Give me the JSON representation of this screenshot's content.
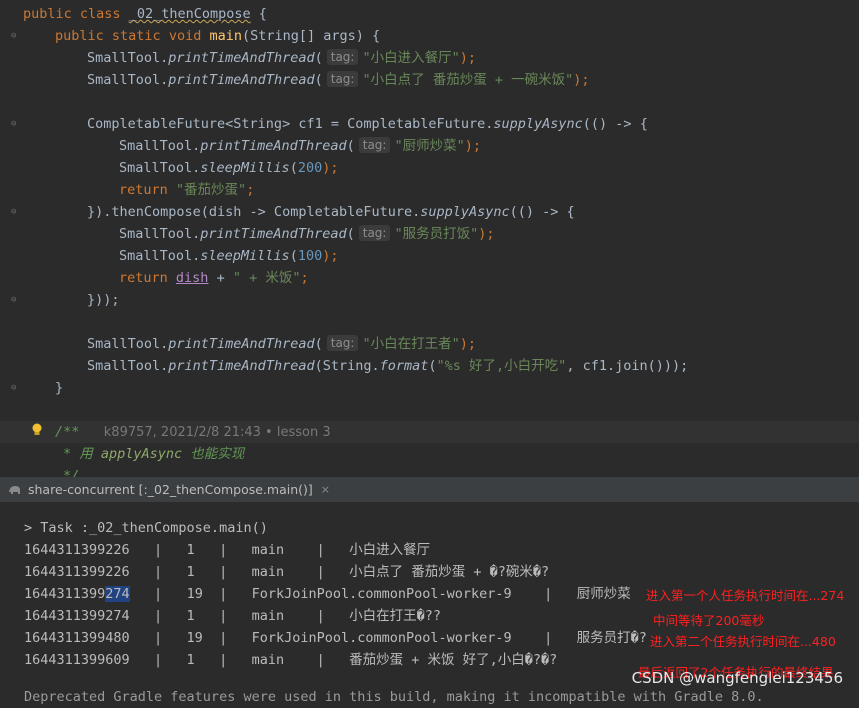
{
  "editor": {
    "class_decl": {
      "kw1": "public",
      "kw2": "class",
      "name": "_02_thenCompose",
      "brace": " {"
    },
    "main_decl": {
      "kw1": "public",
      "kw2": "static",
      "kw3": "void",
      "name": "main",
      "rest": "(String[] args) {"
    },
    "tag_label": "tag:",
    "l1": {
      "obj": "SmallTool.",
      "fn": "printTimeAndThread",
      "open": "(",
      "str": "\"小白进入餐厅\"",
      "close": ");"
    },
    "l2": {
      "obj": "SmallTool.",
      "fn": "printTimeAndThread",
      "open": "(",
      "str": "\"小白点了 番茄炒蛋 + 一碗米饭\"",
      "close": ");"
    },
    "l3": {
      "pre": "CompletableFuture<String> cf1 = CompletableFuture.",
      "fn": "supplyAsync",
      "post": "(() -> {"
    },
    "l4": {
      "obj": "SmallTool.",
      "fn": "printTimeAndThread",
      "open": "(",
      "str": "\"厨师炒菜\"",
      "close": ");"
    },
    "l5": {
      "obj": "SmallTool.",
      "fn": "sleepMillis",
      "open": "(",
      "num": "200",
      "close": ");"
    },
    "l6": {
      "kw": "return",
      "str": "\"番茄炒蛋\"",
      "close": ";"
    },
    "l7": {
      "pre": "}).thenCompose(dish -> CompletableFuture.",
      "fn": "supplyAsync",
      "post": "(() -> {"
    },
    "l8": {
      "obj": "SmallTool.",
      "fn": "printTimeAndThread",
      "open": "(",
      "str": "\"服务员打饭\"",
      "close": ");"
    },
    "l9": {
      "obj": "SmallTool.",
      "fn": "sleepMillis",
      "open": "(",
      "num": "100",
      "close": ");"
    },
    "l10": {
      "kw": "return",
      "var": "dish",
      "mid": " + ",
      "str": "\" + 米饭\"",
      "close": ";"
    },
    "l11": {
      "text": "}));"
    },
    "l12": {
      "obj": "SmallTool.",
      "fn": "printTimeAndThread",
      "open": "(",
      "str": "\"小白在打王者\"",
      "close": ");"
    },
    "l13": {
      "obj": "SmallTool.",
      "fn": "printTimeAndThread",
      "pre2": "(String.",
      "fn2": "format",
      "open": "(",
      "str": "\"%s 好了,小白开吃\"",
      "close": ", cf1.join()));"
    },
    "l14": {
      "text": "}"
    },
    "javadoc": {
      "open": "/**",
      "meta": "k89757, 2021/2/8 21:43 • lesson 3"
    },
    "doc_line": {
      "star": "* 用 ",
      "code": "applyAsync",
      "rest": " 也能实现"
    },
    "doc_end": "*/"
  },
  "run_tab": {
    "label": "share-concurrent [:_02_thenCompose.main()]",
    "close": "×"
  },
  "console": {
    "task_line": "> Task :_02_thenCompose.main()",
    "rows": [
      {
        "text": "1644311399226   |   1   |   main    |   小白进入餐厅"
      },
      {
        "text": "1644311399226   |   1   |   main    |   小白点了 番茄炒蛋 + �?碗米�?"
      },
      {
        "pre": "1644311399",
        "sel": "274",
        "post": "   |   19  |   ForkJoinPool.commonPool-worker-9    |   厨师炒菜"
      },
      {
        "text": "1644311399274   |   1   |   main    |   小白在打王�??"
      },
      {
        "text": "1644311399480   |   19  |   ForkJoinPool.commonPool-worker-9    |   服务员打�?"
      },
      {
        "text": "1644311399609   |   1   |   main    |   番茄炒蛋 + 米饭 好了,小白�?�?"
      }
    ],
    "bottom_partial": "Deprecated Gradle features were used in this build, making it incompatible with Gradle 8.0."
  },
  "annotations": {
    "a1": "进入第一个人任务执行时间在...274",
    "a2": "中间等待了200毫秒",
    "a3": "进入第二个任务执行时间在...480",
    "a4": "最后返回了2个任务执行的最终结果"
  },
  "watermark": "CSDN @wangfenglei123456",
  "colors": {
    "bg": "#2b2b2b",
    "keyword": "#cc7832",
    "method": "#ffc66d",
    "string": "#6a8759",
    "number": "#6897bb",
    "annotation": "#ff2020"
  }
}
